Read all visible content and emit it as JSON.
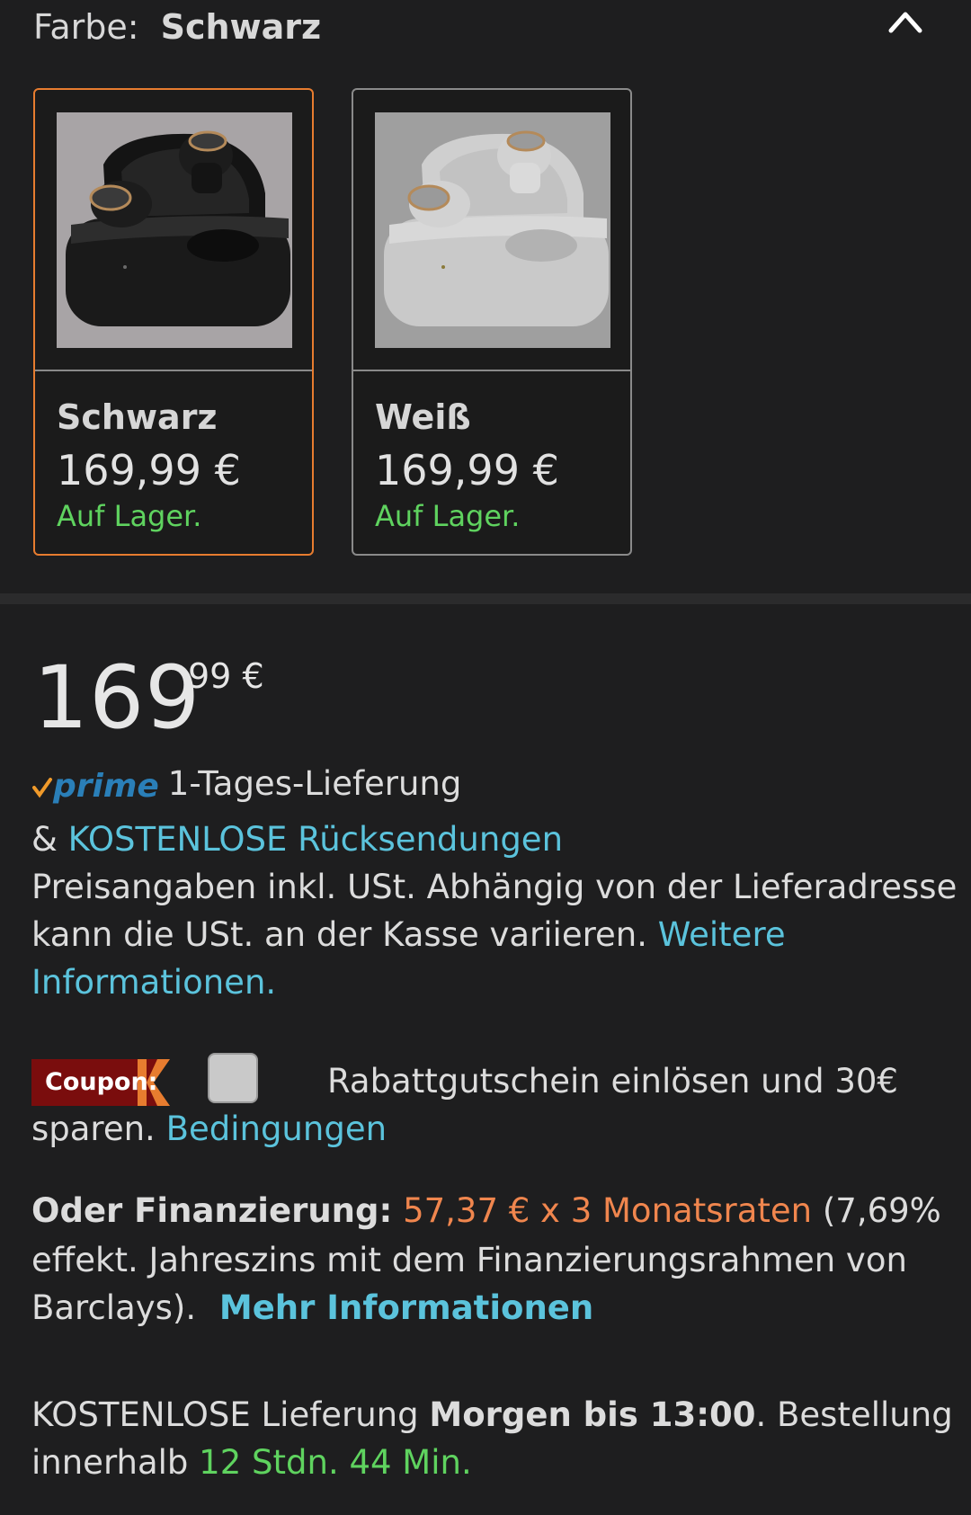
{
  "color_selector": {
    "label": "Farbe:",
    "selected": "Schwarz",
    "collapse_icon": "chevron-up-icon",
    "options": [
      {
        "name": "Schwarz",
        "price": "169,99 €",
        "stock": "Auf Lager.",
        "selected": true
      },
      {
        "name": "Weiß",
        "price": "169,99 €",
        "stock": "Auf Lager.",
        "selected": false
      }
    ]
  },
  "price": {
    "whole": "169",
    "fraction": "99",
    "currency": "€"
  },
  "prime": {
    "logo_text": "prime",
    "delivery": "1-Tages-Lieferung",
    "returns_prefix": "&",
    "returns_link": "KOSTENLOSE Rücksendungen"
  },
  "tax_note": {
    "line1": "Preisangaben inkl. USt. Abhängig von der Lieferadresse",
    "line2": "kann die USt. an der Kasse variieren.",
    "link_part1": "Weitere",
    "link_part2": "Informationen."
  },
  "coupon": {
    "badge": "Coupon:",
    "text_line1": "Rabattgutschein einlösen und 30€",
    "text_line2": "sparen.",
    "terms_link": "Bedingungen"
  },
  "financing": {
    "label": "Oder Finanzierung:",
    "rate": "57,37 € x 3 Monatsraten",
    "after_rate": "(7,69%",
    "line2": "effekt. Jahreszins mit dem Finanzierungsrahmen von",
    "line3": "Barclays).",
    "more_link": "Mehr Informationen"
  },
  "delivery": {
    "prefix": "KOSTENLOSE Lieferung",
    "date": "Morgen bis 13:00",
    "suffix": ". Bestellung",
    "within": "innerhalb",
    "countdown": "12 Stdn. 44 Min."
  },
  "colors": {
    "accent_orange": "#e77c2f",
    "link_blue": "#5bc3dc",
    "stock_green": "#5fd35f",
    "finance_orange": "#f0864e",
    "background": "#1e1e1f"
  }
}
